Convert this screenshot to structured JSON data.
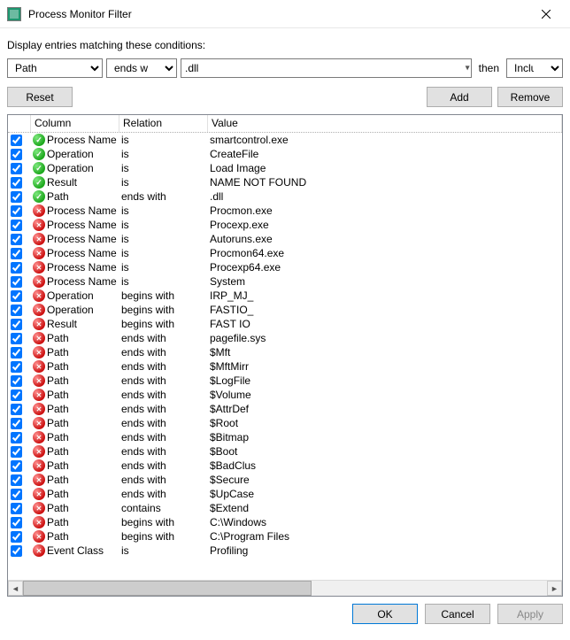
{
  "window": {
    "title": "Process Monitor Filter"
  },
  "instruction": "Display entries matching these conditions:",
  "editor": {
    "column_selected": "Path",
    "relation_selected": "ends with",
    "value": ".dll",
    "then_label": "then",
    "action_selected": "Include"
  },
  "buttons": {
    "reset": "Reset",
    "add": "Add",
    "remove": "Remove",
    "ok": "OK",
    "cancel": "Cancel",
    "apply": "Apply"
  },
  "headers": {
    "column": "Column",
    "relation": "Relation",
    "value": "Value"
  },
  "rows": [
    {
      "checked": true,
      "action": "include",
      "column": "Process Name",
      "relation": "is",
      "value": "smartcontrol.exe"
    },
    {
      "checked": true,
      "action": "include",
      "column": "Operation",
      "relation": "is",
      "value": "CreateFile"
    },
    {
      "checked": true,
      "action": "include",
      "column": "Operation",
      "relation": "is",
      "value": "Load Image"
    },
    {
      "checked": true,
      "action": "include",
      "column": "Result",
      "relation": "is",
      "value": "NAME NOT FOUND"
    },
    {
      "checked": true,
      "action": "include",
      "column": "Path",
      "relation": "ends with",
      "value": ".dll"
    },
    {
      "checked": true,
      "action": "exclude",
      "column": "Process Name",
      "relation": "is",
      "value": "Procmon.exe"
    },
    {
      "checked": true,
      "action": "exclude",
      "column": "Process Name",
      "relation": "is",
      "value": "Procexp.exe"
    },
    {
      "checked": true,
      "action": "exclude",
      "column": "Process Name",
      "relation": "is",
      "value": "Autoruns.exe"
    },
    {
      "checked": true,
      "action": "exclude",
      "column": "Process Name",
      "relation": "is",
      "value": "Procmon64.exe"
    },
    {
      "checked": true,
      "action": "exclude",
      "column": "Process Name",
      "relation": "is",
      "value": "Procexp64.exe"
    },
    {
      "checked": true,
      "action": "exclude",
      "column": "Process Name",
      "relation": "is",
      "value": "System"
    },
    {
      "checked": true,
      "action": "exclude",
      "column": "Operation",
      "relation": "begins with",
      "value": "IRP_MJ_"
    },
    {
      "checked": true,
      "action": "exclude",
      "column": "Operation",
      "relation": "begins with",
      "value": "FASTIO_"
    },
    {
      "checked": true,
      "action": "exclude",
      "column": "Result",
      "relation": "begins with",
      "value": "FAST IO"
    },
    {
      "checked": true,
      "action": "exclude",
      "column": "Path",
      "relation": "ends with",
      "value": "pagefile.sys"
    },
    {
      "checked": true,
      "action": "exclude",
      "column": "Path",
      "relation": "ends with",
      "value": "$Mft"
    },
    {
      "checked": true,
      "action": "exclude",
      "column": "Path",
      "relation": "ends with",
      "value": "$MftMirr"
    },
    {
      "checked": true,
      "action": "exclude",
      "column": "Path",
      "relation": "ends with",
      "value": "$LogFile"
    },
    {
      "checked": true,
      "action": "exclude",
      "column": "Path",
      "relation": "ends with",
      "value": "$Volume"
    },
    {
      "checked": true,
      "action": "exclude",
      "column": "Path",
      "relation": "ends with",
      "value": "$AttrDef"
    },
    {
      "checked": true,
      "action": "exclude",
      "column": "Path",
      "relation": "ends with",
      "value": "$Root"
    },
    {
      "checked": true,
      "action": "exclude",
      "column": "Path",
      "relation": "ends with",
      "value": "$Bitmap"
    },
    {
      "checked": true,
      "action": "exclude",
      "column": "Path",
      "relation": "ends with",
      "value": "$Boot"
    },
    {
      "checked": true,
      "action": "exclude",
      "column": "Path",
      "relation": "ends with",
      "value": "$BadClus"
    },
    {
      "checked": true,
      "action": "exclude",
      "column": "Path",
      "relation": "ends with",
      "value": "$Secure"
    },
    {
      "checked": true,
      "action": "exclude",
      "column": "Path",
      "relation": "ends with",
      "value": "$UpCase"
    },
    {
      "checked": true,
      "action": "exclude",
      "column": "Path",
      "relation": "contains",
      "value": "$Extend"
    },
    {
      "checked": true,
      "action": "exclude",
      "column": "Path",
      "relation": "begins with",
      "value": "C:\\Windows"
    },
    {
      "checked": true,
      "action": "exclude",
      "column": "Path",
      "relation": "begins with",
      "value": "C:\\Program Files"
    },
    {
      "checked": true,
      "action": "exclude",
      "column": "Event Class",
      "relation": "is",
      "value": "Profiling"
    }
  ]
}
